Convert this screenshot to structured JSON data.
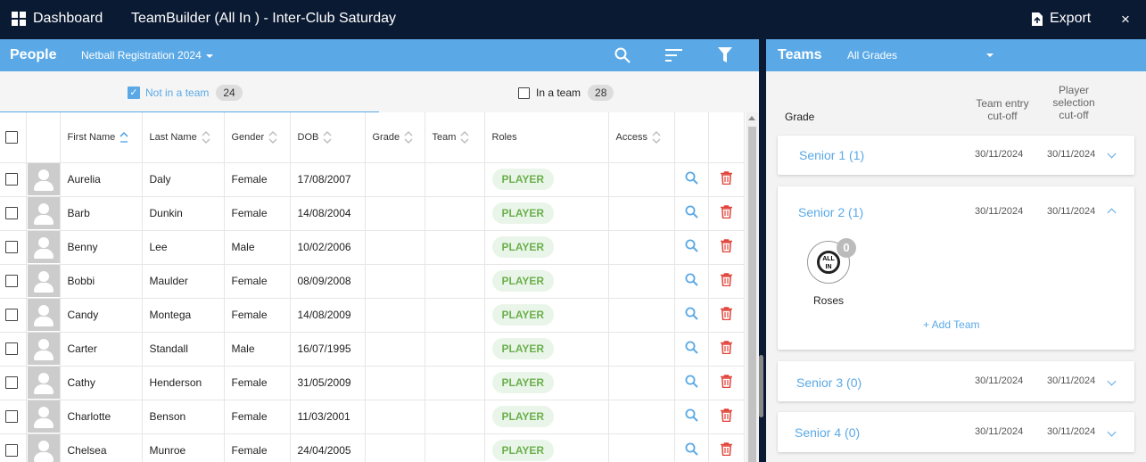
{
  "topbar": {
    "dashboard": "Dashboard",
    "title": "TeamBuilder (All In ) - Inter-Club Saturday",
    "export": "Export",
    "close": "×"
  },
  "people": {
    "title": "People",
    "registration": "Netball Registration 2024",
    "tabs": {
      "not_in_team": "Not in a team",
      "not_in_team_count": "24",
      "in_team": "In a team",
      "in_team_count": "28"
    },
    "columns": [
      "First Name",
      "Last Name",
      "Gender",
      "DOB",
      "Grade",
      "Team",
      "Roles",
      "Access"
    ],
    "rows": [
      {
        "first": "Aurelia",
        "last": "Daly",
        "gender": "Female",
        "dob": "17/08/2007",
        "role": "PLAYER"
      },
      {
        "first": "Barb",
        "last": "Dunkin",
        "gender": "Female",
        "dob": "14/08/2004",
        "role": "PLAYER"
      },
      {
        "first": "Benny",
        "last": "Lee",
        "gender": "Male",
        "dob": "10/02/2006",
        "role": "PLAYER"
      },
      {
        "first": "Bobbi",
        "last": "Maulder",
        "gender": "Female",
        "dob": "08/09/2008",
        "role": "PLAYER"
      },
      {
        "first": "Candy",
        "last": "Montega",
        "gender": "Female",
        "dob": "14/08/2009",
        "role": "PLAYER"
      },
      {
        "first": "Carter",
        "last": "Standall",
        "gender": "Male",
        "dob": "16/07/1995",
        "role": "PLAYER"
      },
      {
        "first": "Cathy",
        "last": "Henderson",
        "gender": "Female",
        "dob": "31/05/2009",
        "role": "PLAYER"
      },
      {
        "first": "Charlotte",
        "last": "Benson",
        "gender": "Female",
        "dob": "11/03/2001",
        "role": "PLAYER"
      },
      {
        "first": "Chelsea",
        "last": "Munroe",
        "gender": "Female",
        "dob": "24/04/2005",
        "role": "PLAYER"
      }
    ]
  },
  "teams": {
    "title": "Teams",
    "grade_filter": "All Grades",
    "header_grade": "Grade",
    "header_entry_l1": "Team entry",
    "header_entry_l2": "cut-off",
    "header_sel_l1": "Player",
    "header_sel_l2": "selection",
    "header_sel_l3": "cut-off",
    "grades": [
      {
        "name": "Senior 1 (1)",
        "entry": "30/11/2024",
        "selection": "30/11/2024"
      },
      {
        "name": "Senior 2 (1)",
        "entry": "30/11/2024",
        "selection": "30/11/2024"
      },
      {
        "name": "Senior 3 (0)",
        "entry": "30/11/2024",
        "selection": "30/11/2024"
      },
      {
        "name": "Senior 4 (0)",
        "entry": "30/11/2024",
        "selection": "30/11/2024"
      }
    ],
    "expanded_team": {
      "name": "Roses",
      "count": "0",
      "logo_text_1": "ALL",
      "logo_text_2": "IN"
    },
    "add_team": "+ Add Team"
  },
  "colors": {
    "accent": "#5aa9e6",
    "navy": "#0b1a33",
    "delete": "#e0443a",
    "role_green": "#6ab04c"
  }
}
